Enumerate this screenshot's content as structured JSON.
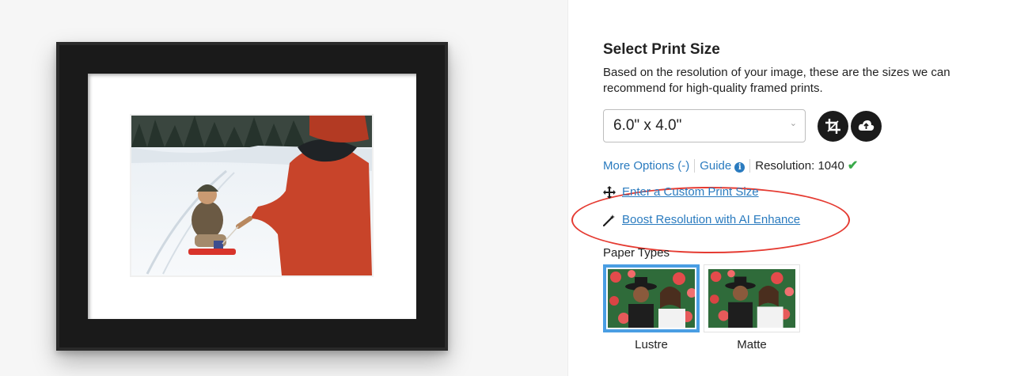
{
  "options": {
    "title": "Select Print Size",
    "description": "Based on the resolution of your image, these are the sizes we can recommend for high-quality framed prints.",
    "size_select": {
      "value": "6.0\" x 4.0\""
    },
    "links": {
      "more_options": "More Options (-)",
      "guide": "Guide",
      "resolution": "Resolution: 1040"
    },
    "custom_size_label": "Enter a Custom Print Size",
    "boost_label": "Boost Resolution with AI Enhance",
    "paper_types_label": "Paper Types",
    "paper_types": [
      {
        "name": "Lustre",
        "selected": true
      },
      {
        "name": "Matte",
        "selected": false
      }
    ]
  },
  "colors": {
    "link": "#2a7bbf",
    "selected_border": "#4a9ee3",
    "highlight": "#e53b32",
    "check": "#3aaa4a"
  },
  "icons": [
    "crop-icon",
    "cloud-upload-icon",
    "info-icon",
    "check-icon",
    "move-arrows-icon",
    "magic-wand-icon",
    "chevron-down-icon"
  ]
}
